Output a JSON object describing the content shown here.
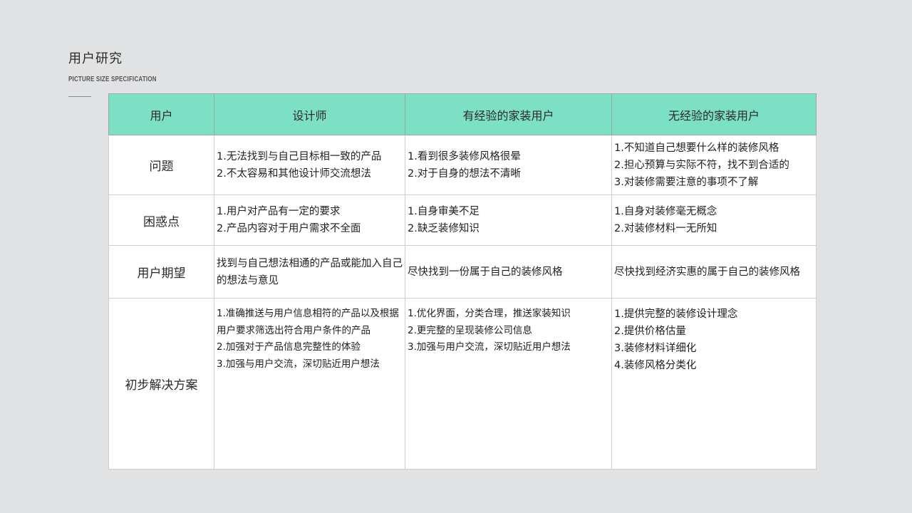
{
  "page": {
    "title": "用户研究",
    "subtitle": "PICTURE SIZE SPECIFICATION"
  },
  "colors": {
    "background": "#e1e2e4",
    "header_fill": "#7de0c4",
    "table_fill": "#ffffff"
  },
  "table": {
    "headers": [
      "用户",
      "设计师",
      "有经验的家装用户",
      "无经验的家装用户"
    ],
    "rows": [
      {
        "label": "问题",
        "designer": [
          "1.无法找到与自己目标相一致的产品",
          "2.不太容易和其他设计师交流想法"
        ],
        "experienced": [
          "1.看到很多装修风格很晕",
          "2.对于自身的想法不清晰"
        ],
        "novice": [
          "1.不知道自己想要什么样的装修风格",
          "2.担心预算与实际不符，找不到合适的",
          "3.对装修需要注意的事项不了解"
        ]
      },
      {
        "label": "困惑点",
        "designer": [
          "1.用户对产品有一定的要求",
          "2.产品内容对于用户需求不全面"
        ],
        "experienced": [
          "1.自身审美不足",
          "2.缺乏装修知识"
        ],
        "novice": [
          "1.自身对装修毫无概念",
          "2.对装修材料一无所知"
        ]
      },
      {
        "label": "用户期望",
        "designer": [
          "找到与自己想法相通的产品或能加入自己的想法与意见"
        ],
        "experienced": [
          "尽快找到一份属于自己的装修风格"
        ],
        "novice": [
          "尽快找到经济实惠的属于自己的装修风格"
        ]
      },
      {
        "label": "初步解决方案",
        "designer": [
          "1.准确推送与用户信息相符的产品以及根据用户要求筛选出符合用户条件的产品",
          "2.加强对于产品信息完整性的体验",
          "3.加强与用户交流，深切贴近用户想法"
        ],
        "experienced": [
          "1.优化界面，分类合理，推送家装知识",
          "2.更完整的呈现装修公司信息",
          "3.加强与用户交流，深切贴近用户想法"
        ],
        "novice": [
          "1.提供完整的装修设计理念",
          "2.提供价格估量",
          "3.装修材料详细化",
          "4.装修风格分类化"
        ]
      }
    ]
  }
}
